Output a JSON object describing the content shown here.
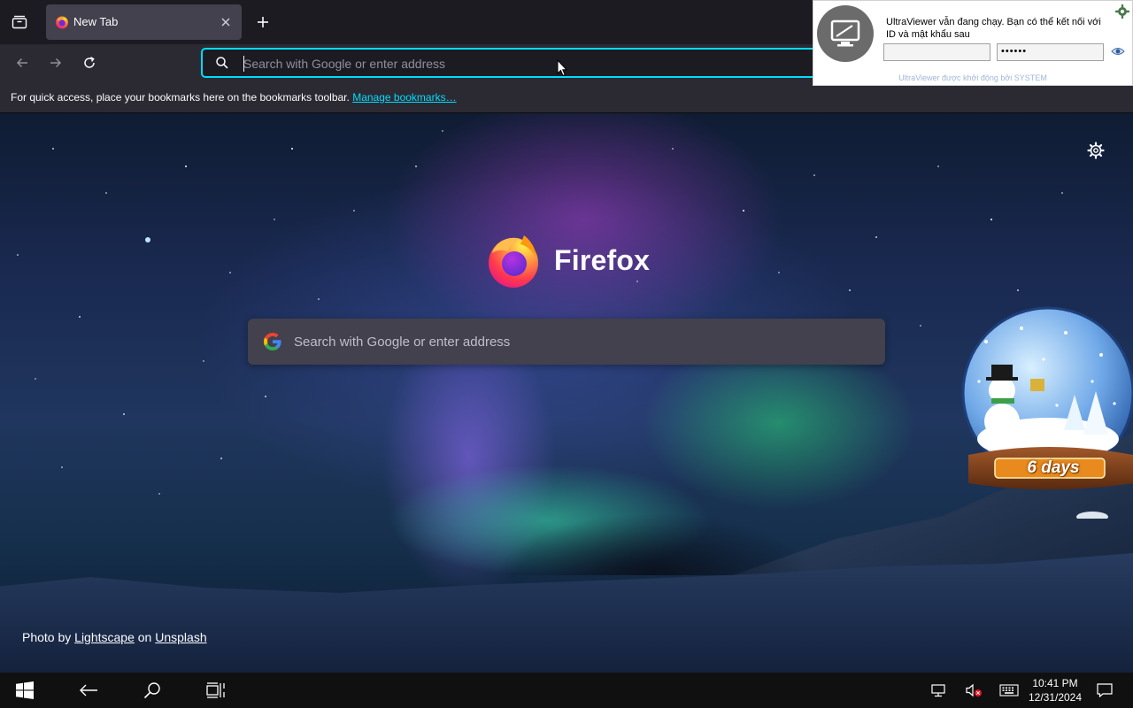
{
  "browser": {
    "tab": {
      "title": "New Tab"
    },
    "urlbar": {
      "placeholder": "Search with Google or enter address"
    },
    "bookmarks_bar": {
      "message": "For quick access, place your bookmarks here on the bookmarks toolbar.",
      "link": "Manage bookmarks…"
    }
  },
  "newtab": {
    "brand": "Firefox",
    "search_placeholder": "Search with Google or enter address",
    "credit": {
      "prefix": "Photo by",
      "author": "Lightscape",
      "middle": "on",
      "source": "Unsplash"
    }
  },
  "snow_globe": {
    "days": "6 days"
  },
  "ultraviewer": {
    "message": "UltraViewer vẫn đang chạy. Bạn có thể kết nối với ID và mật khẩu sau",
    "id_value": "",
    "password_value": "••••••",
    "footer": "UltraViewer được khởi động bởi SYSTEM"
  },
  "taskbar": {
    "time": "10:41 PM",
    "date": "12/31/2024"
  },
  "colors": {
    "accent": "#00ddff",
    "toolbar": "#2b2a33",
    "tabbar": "#1c1b22",
    "taskbar": "#101010"
  },
  "icons": [
    "tab-list-icon",
    "firefox-icon",
    "close-icon",
    "plus-icon",
    "back-icon",
    "forward-icon",
    "reload-icon",
    "search-icon",
    "gear-icon",
    "google-icon",
    "monitor-icon",
    "eye-icon",
    "windows-icon",
    "task-view-icon",
    "network-icon",
    "volume-muted-icon",
    "keyboard-icon",
    "notification-icon"
  ]
}
